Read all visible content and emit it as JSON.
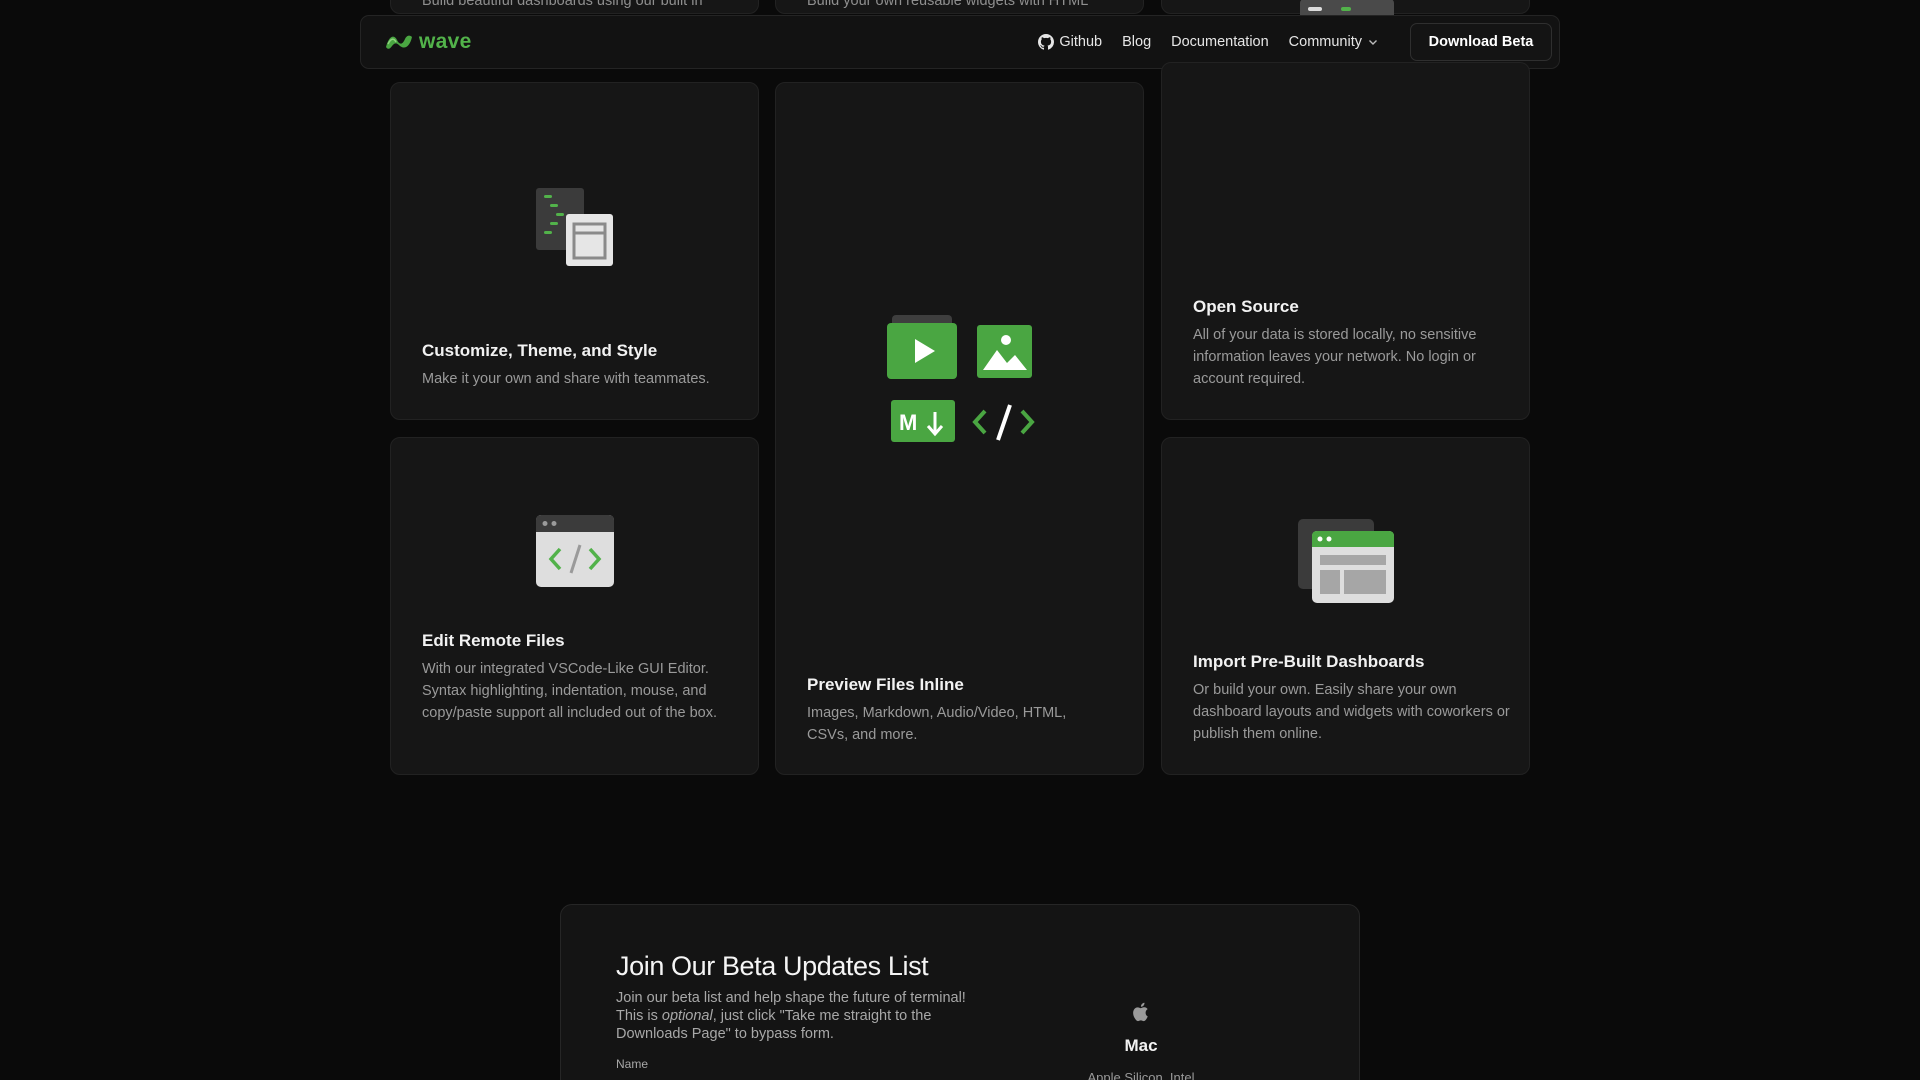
{
  "nav": {
    "logo_text": "wave",
    "links": [
      "Github",
      "Blog",
      "Documentation",
      "Community"
    ],
    "download_label": "Download Beta"
  },
  "top_cut": {
    "col1": "Build beautiful dashboards using our built in",
    "col2": "Build your own reusable widgets with HTML"
  },
  "features": {
    "customize": {
      "title": "Customize, Theme, and Style",
      "desc": "Make it your own and share with teammates."
    },
    "preview": {
      "title": "Preview Files Inline",
      "desc": "Images, Markdown, Audio/Video, HTML, CSVs, and more."
    },
    "open_source": {
      "title": "Open Source",
      "desc": "All of your data is stored locally, no sensitive information leaves your network. No login or account required."
    },
    "edit_remote": {
      "title": "Edit Remote Files",
      "desc": "With our integrated VSCode-Like GUI Editor. Syntax highlighting, indentation, mouse, and copy/paste support all included out of the box."
    },
    "import_dash": {
      "title": "Import Pre-Built Dashboards",
      "desc": "Or build your own. Easily share your own dashboard layouts and widgets with coworkers or publish them online."
    }
  },
  "newsletter": {
    "title": "Join Our Beta Updates List",
    "desc_prefix": "Join our beta list and help shape the future of terminal!  This is ",
    "desc_em": "optional",
    "desc_suffix": ", just click \"Take me straight to the Downloads Page\" to bypass form.",
    "name_label": "Name",
    "mac_label": "Mac",
    "mac_sub": "Apple Silicon, Intel"
  },
  "colors": {
    "accent": "#52b24a",
    "bg": "#0a0a0a",
    "card": "#161616"
  }
}
